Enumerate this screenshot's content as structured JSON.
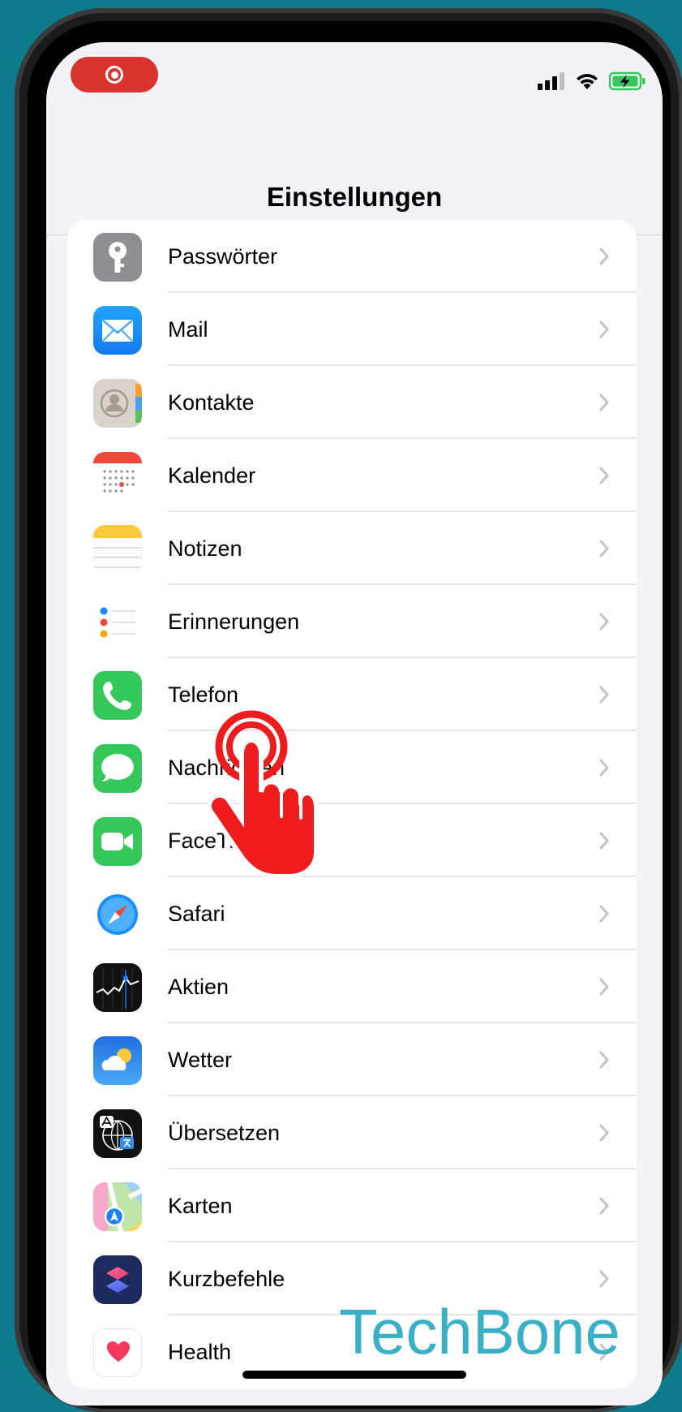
{
  "nav": {
    "title": "Einstellungen"
  },
  "colors": {
    "background": "#0e7b8c",
    "screen": "#f2f2f7",
    "record": "#d9342b",
    "watermark": "#3ab0c7",
    "hand": "#ee1c1c",
    "battery": "#34c759"
  },
  "settings": {
    "items": [
      {
        "label": "Passwörter",
        "icon": "key-icon"
      },
      {
        "label": "Mail",
        "icon": "mail-icon"
      },
      {
        "label": "Kontakte",
        "icon": "contacts-icon"
      },
      {
        "label": "Kalender",
        "icon": "calendar-icon"
      },
      {
        "label": "Notizen",
        "icon": "notes-icon"
      },
      {
        "label": "Erinnerungen",
        "icon": "reminders-icon"
      },
      {
        "label": "Telefon",
        "icon": "phone-icon"
      },
      {
        "label": "Nachrichten",
        "icon": "messages-icon"
      },
      {
        "label": "FaceTime",
        "icon": "facetime-icon"
      },
      {
        "label": "Safari",
        "icon": "safari-icon"
      },
      {
        "label": "Aktien",
        "icon": "stocks-icon"
      },
      {
        "label": "Wetter",
        "icon": "weather-icon"
      },
      {
        "label": "Übersetzen",
        "icon": "translate-icon"
      },
      {
        "label": "Karten",
        "icon": "maps-icon"
      },
      {
        "label": "Kurzbefehle",
        "icon": "shortcuts-icon"
      },
      {
        "label": "Health",
        "icon": "health-icon"
      }
    ]
  },
  "watermark": {
    "text": "TechBone"
  }
}
